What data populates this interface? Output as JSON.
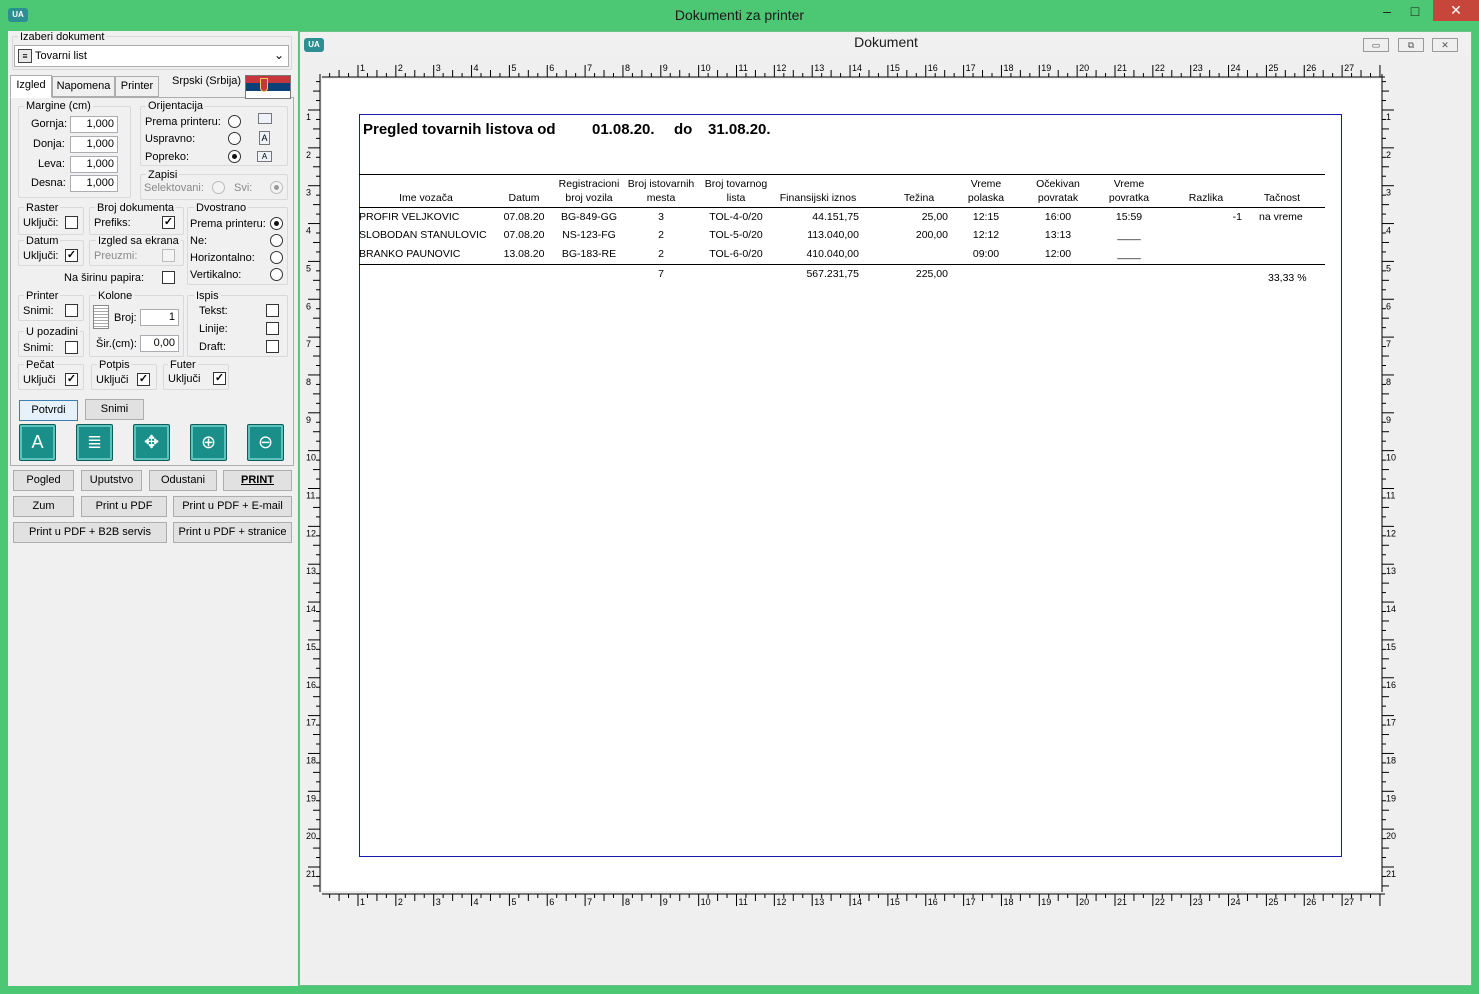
{
  "window": {
    "title": "Dokumenti za printer",
    "icon": "app-logo-icon"
  },
  "left": {
    "doc_group_label": "Izaberi dokument",
    "doc_select": "Tovarni list",
    "tabs": [
      "Izgled",
      "Napomena",
      "Printer"
    ],
    "language": "Srpski (Srbija)",
    "margins": {
      "label": "Margine (cm)",
      "rows": [
        {
          "name": "Gornja:",
          "value": "1,000"
        },
        {
          "name": "Donja:",
          "value": "1,000"
        },
        {
          "name": "Leva:",
          "value": "1,000"
        },
        {
          "name": "Desna:",
          "value": "1,000"
        }
      ]
    },
    "orientation": {
      "label": "Orijentacija",
      "rows": [
        "Prema printeru:",
        "Uspravno:",
        "Popreko:"
      ],
      "selected": 2
    },
    "zapisi": {
      "label": "Zapisi",
      "selektovani": "Selektovani:",
      "svi": "Svi:"
    },
    "raster": {
      "label": "Raster",
      "ukljuci": "Uključi:"
    },
    "broj_dok": {
      "label": "Broj dokumenta",
      "prefiks": "Prefiks:"
    },
    "dvostrano": {
      "label": "Dvostrano",
      "rows": [
        "Prema printeru:",
        "Ne:",
        "Horizontalno:",
        "Vertikalno:"
      ],
      "selected": 0
    },
    "datum": {
      "label": "Datum",
      "ukljuci": "Uključi:"
    },
    "izgled_ekrana": {
      "label": "Izgled sa ekrana",
      "preuzmi": "Preuzmi:"
    },
    "sirina": "Na širinu papira:",
    "printer": {
      "label": "Printer",
      "snimi": "Snimi:"
    },
    "kolone": {
      "label": "Kolone",
      "broj_label": "Broj:",
      "broj": "1",
      "sir_label": "Šir.(cm):",
      "sir": "0,00"
    },
    "ispis": {
      "label": "Ispis",
      "rows": [
        "Tekst:",
        "Linije:",
        "Draft:"
      ]
    },
    "u_pozadini": {
      "label": "U pozadini",
      "snimi": "Snimi:"
    },
    "pecat": {
      "label": "Pečat",
      "ukljuci": "Uključi"
    },
    "potpis": {
      "label": "Potpis",
      "ukljuci": "Uključi"
    },
    "futer": {
      "label": "Futer",
      "ukljuci": "Uključi"
    },
    "confirm_btn": "Potvrdi",
    "save_btn": "Snimi",
    "bottom_buttons": [
      [
        "Pogled",
        "Uputstvo",
        "Odustani",
        "PRINT"
      ],
      [
        "Zum",
        "Print u PDF",
        "Print u PDF + E-mail"
      ],
      [
        "Print u PDF + B2B servis",
        "Print u PDF + stranice"
      ]
    ]
  },
  "document": {
    "title": "Dokument",
    "report_title": "Pregled tovarnih listova od",
    "date_from": "01.08.20.",
    "do": "do",
    "date_to": "31.08.20.",
    "columns": [
      [
        "Ime vozača"
      ],
      [
        "Datum"
      ],
      [
        "Registracioni",
        "broj vozila"
      ],
      [
        "Broj istovarnih",
        "mesta"
      ],
      [
        "Broj tovarnog",
        "lista"
      ],
      [
        "Finansijski iznos"
      ],
      [
        "Težina"
      ],
      [
        "Vreme",
        "polaska"
      ],
      [
        "Očekivan",
        "povratak"
      ],
      [
        "Vreme",
        "povratka"
      ],
      [
        "Razlika"
      ],
      [
        "Tačnost"
      ]
    ],
    "rows": [
      [
        "PROFIR VELJKOVIC",
        "07.08.20",
        "BG-849-GG",
        "3",
        "TOL-4-0/20",
        "44.151,75",
        "25,00",
        "12:15",
        "16:00",
        "15:59",
        "-1",
        "na vreme"
      ],
      [
        "SLOBODAN STANULOVIC",
        "07.08.20",
        "NS-123-FG",
        "2",
        "TOL-5-0/20",
        "113.040,00",
        "200,00",
        "12:12",
        "13:13",
        "____",
        "",
        ""
      ],
      [
        "BRANKO PAUNOVIC",
        "13.08.20",
        "BG-183-RE",
        "2",
        "TOL-6-0/20",
        "410.040,00",
        "",
        "09:00",
        "12:00",
        "____",
        "",
        ""
      ]
    ],
    "totals": {
      "mesta": "7",
      "iznos": "567.231,75",
      "tezina": "225,00",
      "tacnost": "33,33 %"
    },
    "ruler_numbers": [
      "1",
      "2",
      "3",
      "4",
      "5",
      "6",
      "7",
      "8",
      "9",
      "10",
      "11",
      "12",
      "13",
      "14",
      "15",
      "16",
      "17",
      "18",
      "19",
      "20",
      "21",
      "22",
      "23",
      "24",
      "25",
      "26",
      "27"
    ],
    "ruler_numbers_v": [
      "1",
      "2",
      "3",
      "4",
      "5",
      "6",
      "7",
      "8",
      "9",
      "10",
      "11",
      "12",
      "13",
      "14",
      "15",
      "16",
      "17",
      "18",
      "19",
      "20",
      "21"
    ]
  }
}
